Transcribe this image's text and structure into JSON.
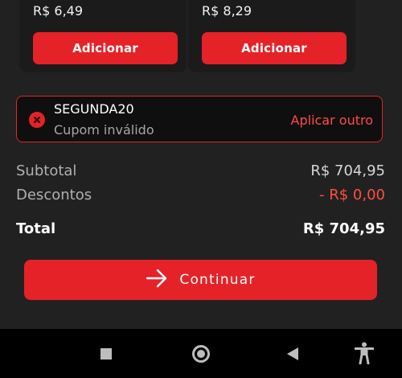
{
  "products": [
    {
      "price": "R$ 6,49",
      "button_label": "Adicionar"
    },
    {
      "price": "R$ 8,29",
      "button_label": "Adicionar"
    }
  ],
  "coupon": {
    "code": "SEGUNDA20",
    "status": "Cupom inválido",
    "action_label": "Aplicar outro",
    "icon": "error-x-icon"
  },
  "summary": {
    "subtotal_label": "Subtotal",
    "subtotal_value": "R$ 704,95",
    "discount_label": "Descontos",
    "discount_value": "- R$ 0,00",
    "total_label": "Total",
    "total_value": "R$ 704,95"
  },
  "continue": {
    "label": "Continuar",
    "icon": "arrow-right-icon"
  },
  "nav_bar": {
    "icons": [
      "stop-square-icon",
      "home-circle-icon",
      "back-triangle-icon",
      "accessibility-icon"
    ]
  },
  "colors": {
    "background": "#212121",
    "accent": "#e52228",
    "discount": "#ff4e42"
  }
}
